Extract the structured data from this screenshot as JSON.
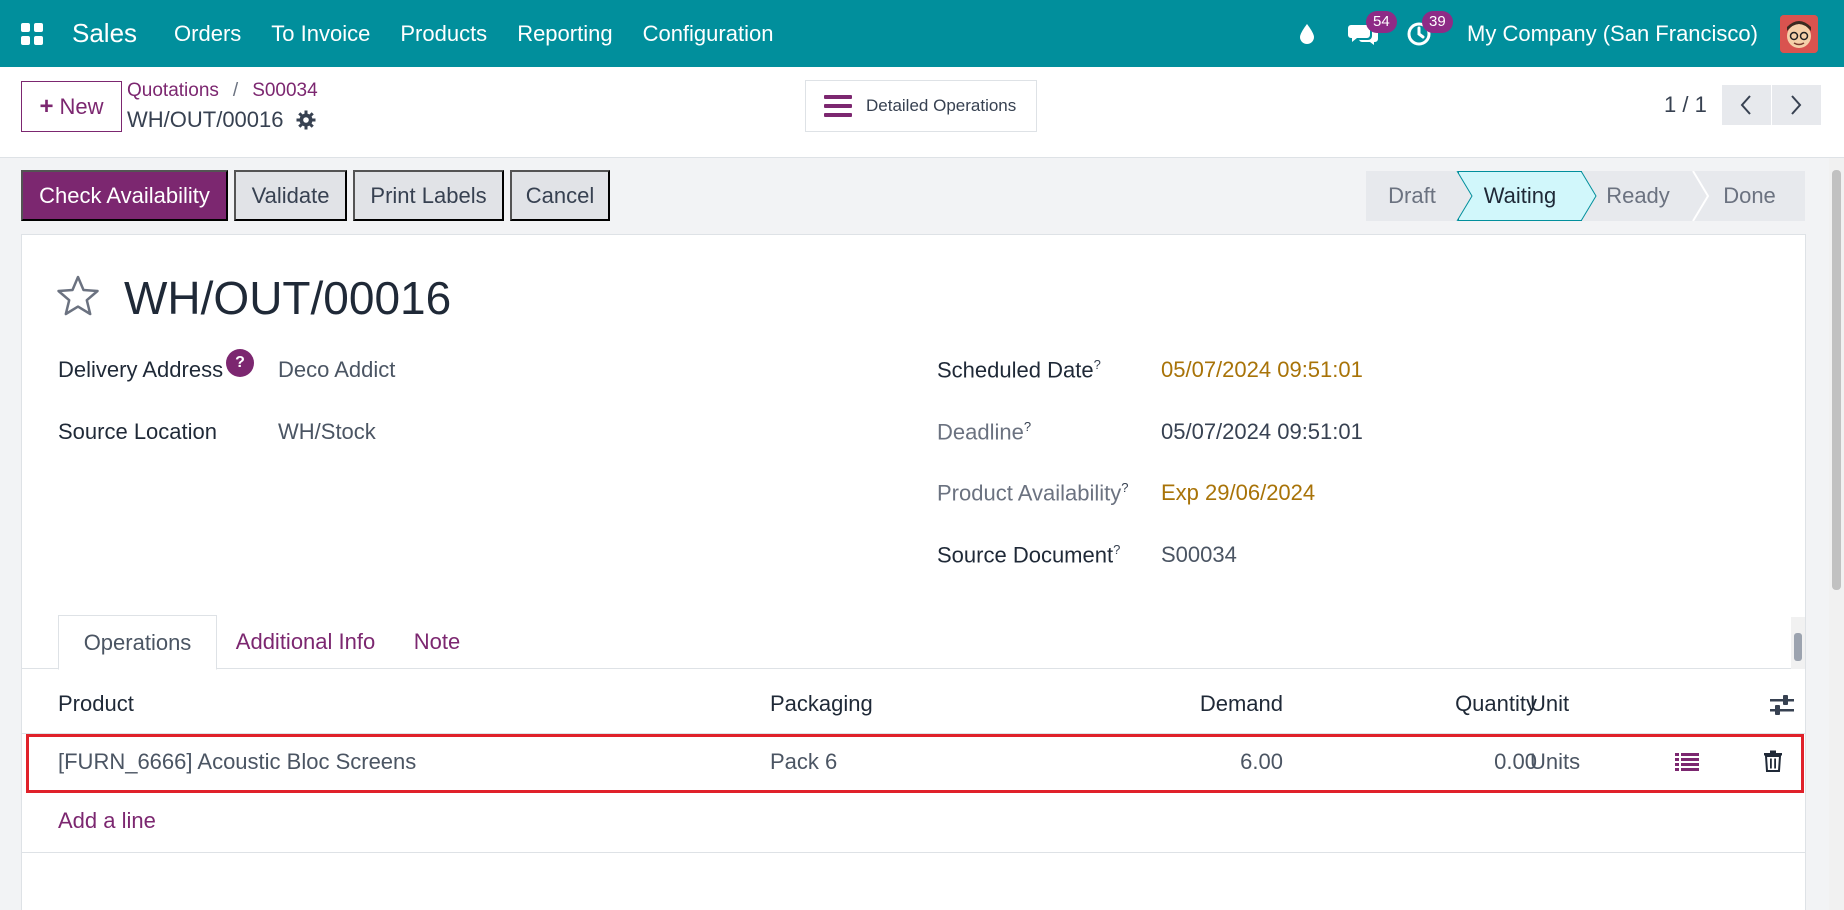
{
  "navbar": {
    "app_name": "Sales",
    "menu": [
      "Orders",
      "To Invoice",
      "Products",
      "Reporting",
      "Configuration"
    ],
    "messages_count": "54",
    "activities_count": "39",
    "company": "My Company (San Francisco)",
    "color": "#018f9c"
  },
  "control_panel": {
    "new_label": "New",
    "breadcrumb": [
      "Quotations",
      "S00034"
    ],
    "record_name": "WH/OUT/00016",
    "detailed_operations_label": "Detailed Operations",
    "pager": "1 / 1"
  },
  "actions": {
    "check_availability": "Check Availability",
    "validate": "Validate",
    "print_labels": "Print Labels",
    "cancel": "Cancel"
  },
  "statusbar": {
    "stages": [
      "Draft",
      "Waiting",
      "Ready",
      "Done"
    ],
    "active": "Waiting"
  },
  "form": {
    "title": "WH/OUT/00016",
    "delivery_address_label": "Delivery Address",
    "delivery_address_help": "?",
    "delivery_address": "Deco Addict",
    "source_location_label": "Source Location",
    "source_location": "WH/Stock",
    "scheduled_date_label": "Scheduled Date",
    "scheduled_date": "05/07/2024 09:51:01",
    "deadline_label": "Deadline",
    "deadline": "05/07/2024 09:51:01",
    "product_availability_label": "Product Availability",
    "product_availability": "Exp 29/06/2024",
    "source_document_label": "Source Document",
    "source_document": "S00034",
    "help_mark": "?"
  },
  "tabs": [
    "Operations",
    "Additional Info",
    "Note"
  ],
  "table": {
    "headers": {
      "product": "Product",
      "packaging": "Packaging",
      "demand": "Demand",
      "quantity": "Quantity",
      "unit": "Unit"
    },
    "rows": [
      {
        "product": "[FURN_6666] Acoustic Bloc Screens",
        "packaging": "Pack 6",
        "demand": "6.00",
        "quantity": "0.00",
        "unit": "Units"
      }
    ],
    "add_line": "Add a line"
  },
  "colors": {
    "primary": "#7c2770",
    "warning_text": "#a87308",
    "highlight_border": "#e0212a"
  }
}
